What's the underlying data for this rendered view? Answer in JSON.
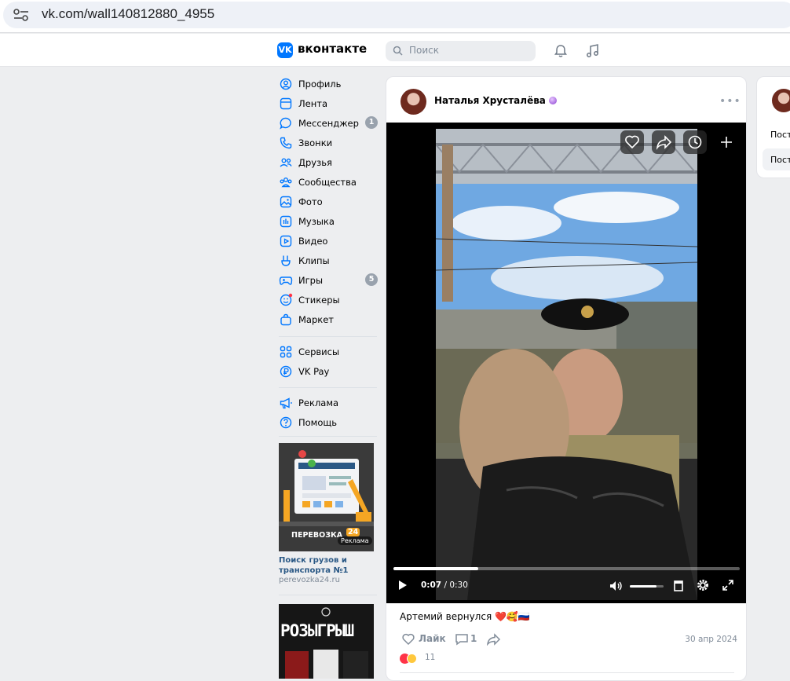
{
  "browser": {
    "url": "vk.com/wall140812880_4955",
    "site_info_icon": "tune-icon"
  },
  "header": {
    "brand": "вконтакте",
    "logo_text": "VK",
    "search_placeholder": "Поиск",
    "icons": [
      "bell-icon",
      "music-note-icon"
    ],
    "accent": "#0077ff"
  },
  "sidebar": {
    "items": [
      {
        "label": "Профиль",
        "icon": "profile-icon"
      },
      {
        "label": "Лента",
        "icon": "feed-icon"
      },
      {
        "label": "Мессенджер",
        "icon": "messenger-icon",
        "badge": "1"
      },
      {
        "label": "Звонки",
        "icon": "phone-icon"
      },
      {
        "label": "Друзья",
        "icon": "friends-icon"
      },
      {
        "label": "Сообщества",
        "icon": "communities-icon"
      },
      {
        "label": "Фото",
        "icon": "photo-icon"
      },
      {
        "label": "Музыка",
        "icon": "music-icon"
      },
      {
        "label": "Видео",
        "icon": "video-icon"
      },
      {
        "label": "Клипы",
        "icon": "clips-icon"
      },
      {
        "label": "Игры",
        "icon": "games-icon",
        "badge": "5"
      },
      {
        "label": "Стикеры",
        "icon": "stickers-icon"
      },
      {
        "label": "Маркет",
        "icon": "market-icon"
      }
    ],
    "items2": [
      {
        "label": "Сервисы",
        "icon": "services-icon"
      },
      {
        "label": "VK Pay",
        "icon": "vkpay-icon"
      }
    ],
    "items3": [
      {
        "label": "Реклама",
        "icon": "megaphone-icon"
      },
      {
        "label": "Помощь",
        "icon": "help-icon"
      }
    ],
    "ad": {
      "image_brand": "ПЕРЕВОЗКА",
      "image_brand_num": "24",
      "image_badge": "Реклама",
      "title": "Поиск грузов и транспорта №1",
      "link": "perevozka24.ru"
    },
    "ad2_text": "РОЗЫГРЫШ"
  },
  "post": {
    "author": "Наталья Хрусталёва",
    "author_badge_icon": "purple-orb-emoji",
    "menu_icon": "more-dots-icon",
    "video": {
      "time_current": "0:07",
      "time_total": "0:30",
      "progress": 0.245,
      "volume": 0.8,
      "overlay_buttons": [
        "heart-icon",
        "share-icon",
        "clock-icon",
        "plus-icon"
      ]
    },
    "caption": "Артемий вернулся ❤️🥰🇷🇺",
    "like_label": "Лайк",
    "comments_count": "1",
    "date": "30 апр 2024",
    "reactions_count": "11"
  },
  "right_panel": {
    "tabs": [
      "Пост",
      "Пост"
    ]
  }
}
